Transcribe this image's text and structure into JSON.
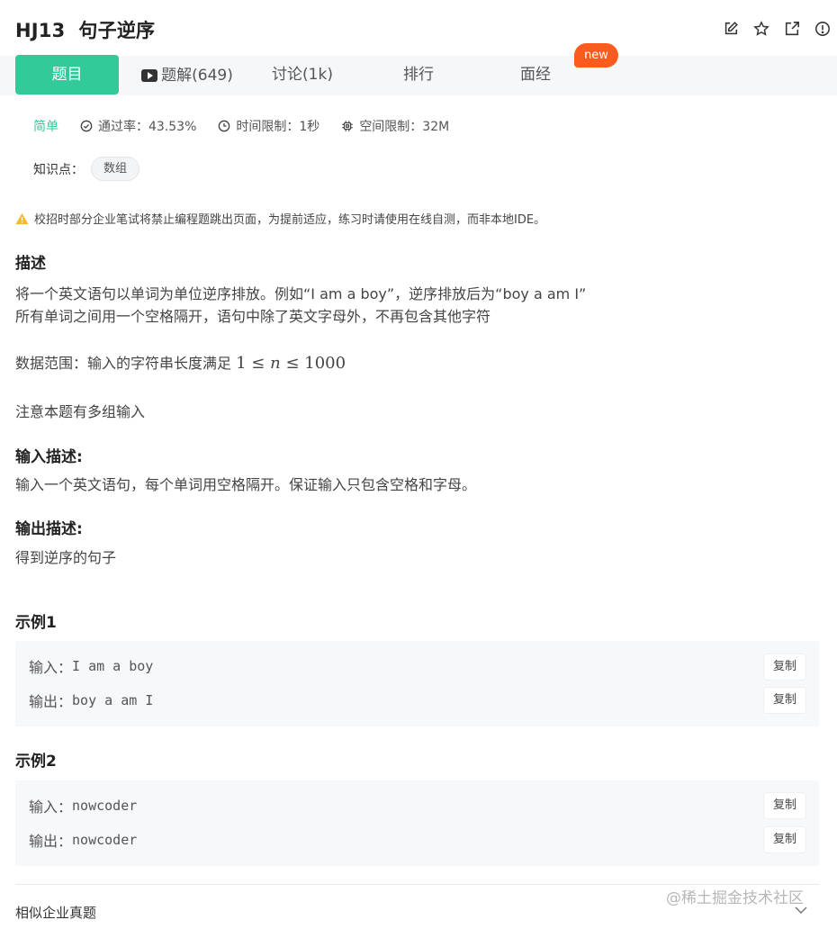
{
  "header": {
    "title": "HJ13  句子逆序",
    "icons": [
      "edit-icon",
      "star-icon",
      "external-link-icon",
      "report-icon"
    ]
  },
  "tabs": {
    "problem": "题目",
    "solutions": "题解(649)",
    "discuss": "讨论(1k)",
    "rank": "排行",
    "interview": "面经",
    "new_badge": "new",
    "active_color": "#32ca99",
    "badge_color": "#fa5b1e"
  },
  "meta": {
    "difficulty": "简单",
    "pass_rate": "通过率：43.53%",
    "time_limit": "时间限制：1秒",
    "memory_limit": "空间限制：32M"
  },
  "tags": {
    "label": "知识点：",
    "items": [
      "数组"
    ]
  },
  "notice": "校招时部分企业笔试将禁止编程题跳出页面，为提前适应，练习时请使用在线自测，而非本地IDE。",
  "description": {
    "title": "描述",
    "line1": "将一个英文语句以单词为单位逆序排放。例如“I am a boy”，逆序排放后为“boy a am I”",
    "line2": "所有单词之间用一个空格隔开，语句中除了英文字母外，不再包含其他字符",
    "range_prefix": "数据范围：输入的字符串长度满足 ",
    "range_min": "1",
    "range_le": "≤",
    "range_var": "n",
    "range_max": "1000",
    "note": "注意本题有多组输入"
  },
  "input_desc": {
    "title": "输入描述:",
    "text": "输入一个英文语句，每个单词用空格隔开。保证输入只包含空格和字母。"
  },
  "output_desc": {
    "title": "输出描述:",
    "text": "得到逆序的句子"
  },
  "examples": [
    {
      "title": "示例1",
      "input_label": "输入：",
      "input": "I am a boy",
      "output_label": "输出：",
      "output": "boy a am I",
      "copy": "复制"
    },
    {
      "title": "示例2",
      "input_label": "输入：",
      "input": "nowcoder",
      "output_label": "输出：",
      "output": "nowcoder",
      "copy": "复制"
    }
  ],
  "similar": "相似企业真题",
  "watermark": "@稀土掘金技术社区"
}
